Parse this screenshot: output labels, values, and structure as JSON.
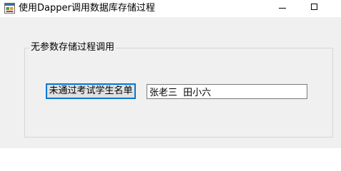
{
  "window": {
    "title": "使用Dapper调用数据库存储过程",
    "app_icon": "winforms-app-icon",
    "minimize_icon": "minimize-icon",
    "maximize_icon": "maximize-icon"
  },
  "group": {
    "label": "无参数存储过程调用"
  },
  "query_button": {
    "label": "未通过考试学生名单"
  },
  "result_field": {
    "value": "张老三  田小六"
  },
  "colors": {
    "titlebar_bg": "#ffffff",
    "window_bg": "#f0f0f0",
    "button_bg": "#e1e1e1",
    "button_focus_border": "#0078d7",
    "textbox_border": "#7a7a7a",
    "groupbox_border": "#d5d5d5"
  }
}
